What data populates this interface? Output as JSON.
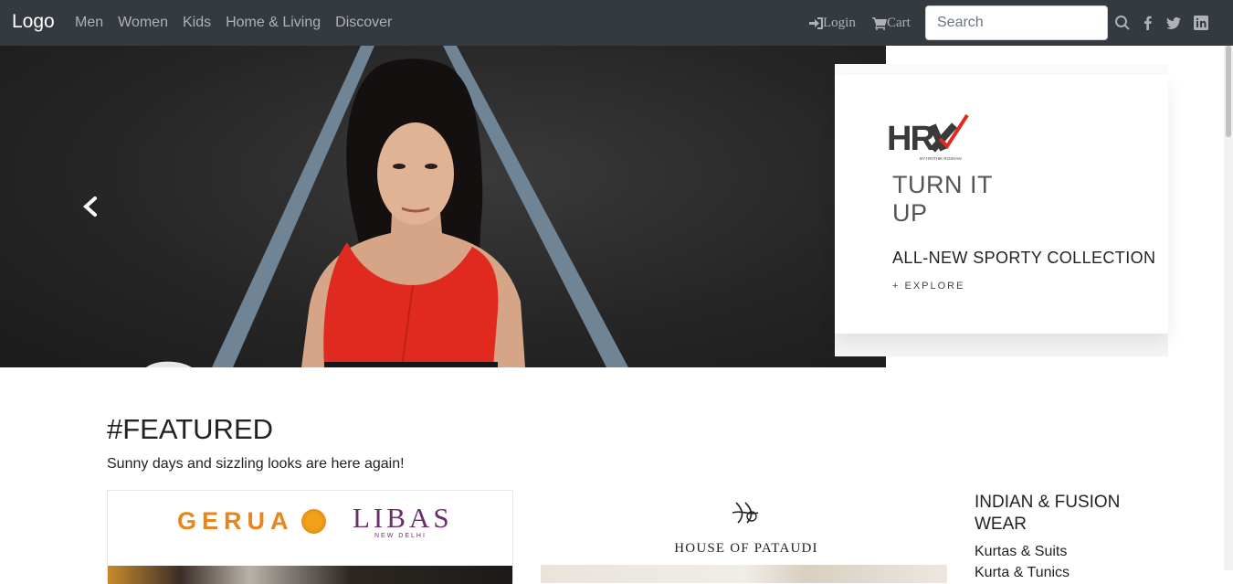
{
  "navbar": {
    "brand": "Logo",
    "links": [
      "Men",
      "Women",
      "Kids",
      "Home & Living",
      "Discover"
    ],
    "login_label": "Login",
    "cart_label": "Cart",
    "search_placeholder": "Search"
  },
  "hero": {
    "brand_logo_text": "HRX",
    "brand_logo_subtext": "BY HRITHIK ROSHAN",
    "tagline_line1": "TURN IT",
    "tagline_line2": "UP",
    "headline": "ALL-NEW SPORTY COLLECTION",
    "cta": "+ EXPLORE"
  },
  "featured": {
    "title": "#FEATURED",
    "subtitle": "Sunny days and sizzling looks are here again!",
    "card1": {
      "brand_a": "GERUA",
      "brand_b": "LIBAS",
      "brand_b_sub": "NEW DELHI"
    },
    "card2": {
      "brand": "HOUSE OF PATAUDI"
    },
    "category": {
      "title": "INDIAN & FUSION WEAR",
      "items": [
        "Kurtas & Suits",
        "Kurta & Tunics"
      ]
    }
  },
  "colors": {
    "navbar_bg": "#343a40",
    "nav_link": "#aeb2b6",
    "hero_bg": "#262626",
    "accent_red": "#e02a1f"
  }
}
